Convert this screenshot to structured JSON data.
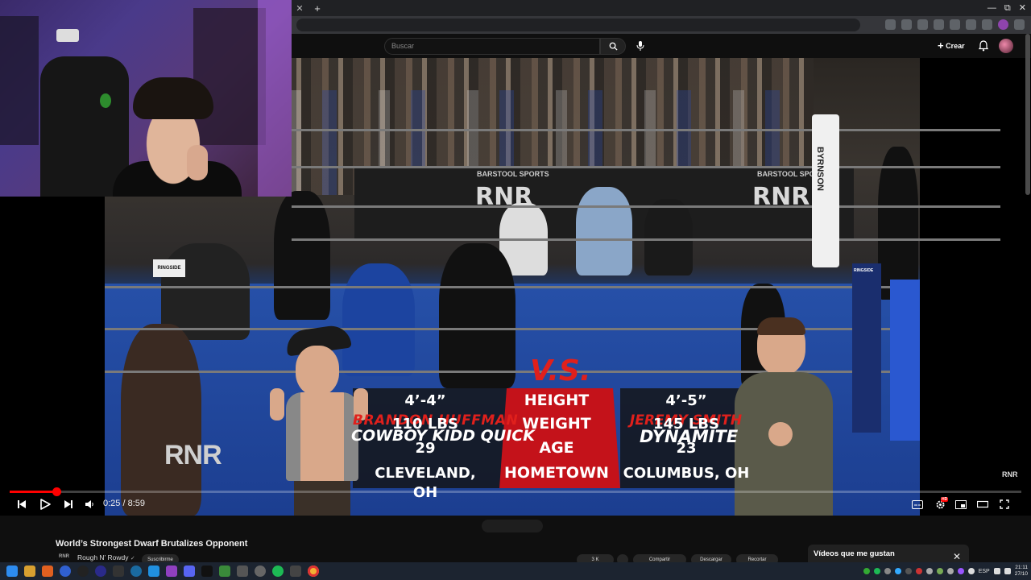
{
  "browser": {
    "window_controls": {
      "minimize": "—",
      "maximize": "⧉",
      "close": "✕"
    },
    "new_tab_symbol": "+",
    "close_tab_symbol": "✕"
  },
  "youtube": {
    "search_placeholder": "Buscar",
    "create_label": "Crear",
    "create_symbol": "+"
  },
  "overlay": {
    "fighter_left": {
      "first_line": "BRANDON HUFFMAN",
      "second_line": "COWBOY KIDD QUICK",
      "height": "4’-4”",
      "weight": "110 LBS",
      "age": "29",
      "hometown": "CLEVELAND, OH"
    },
    "vs": "V.S.",
    "fighter_right": {
      "first_line": "JEREMY SMITH",
      "second_line": "DYNAMITE",
      "height": "4’-5”",
      "weight": "145 LBS",
      "age": "23",
      "hometown": "COLUMBUS, OH"
    },
    "labels": {
      "height": "HEIGHT",
      "weight": "WEIGHT",
      "age": "AGE",
      "hometown": "HOMETOWN"
    },
    "watermark": "RNR",
    "corner_mark": "RNR",
    "banner_text_left": "RNR",
    "banner_text_right": "RNR",
    "banner_brand": "BARSTOOL SPORTS",
    "corner_post_text": "BYRNSON",
    "ringside_left": "RINGSIDE",
    "ringside_right": "RINGSIDE"
  },
  "player": {
    "time_current": "0:25",
    "time_separator": " / ",
    "time_total": "8:59",
    "progress_fraction": 0.046,
    "hd_badge": "HD"
  },
  "video_info": {
    "title": "World’s Strongest Dwarf Brutalizes Opponent",
    "channel_name": "Rough N’ Rowdy",
    "channel_verified": "✓",
    "channel_icon_text": "RNR",
    "subscribe_label": "Suscribirme",
    "likes": "3 K",
    "share_label": "Compartir",
    "save_label": "Descargar",
    "clip_label": "Recortar"
  },
  "liked_panel": {
    "title": "Vídeos que me gustan",
    "close_symbol": "✕"
  },
  "taskbar": {
    "language": "ESP",
    "time": "21:11",
    "date": "27/10"
  },
  "colors": {
    "youtube_red": "#ff0000",
    "overlay_red": "#c4121a",
    "name_red": "#e0201c",
    "page_bg": "#0f0f0f"
  }
}
